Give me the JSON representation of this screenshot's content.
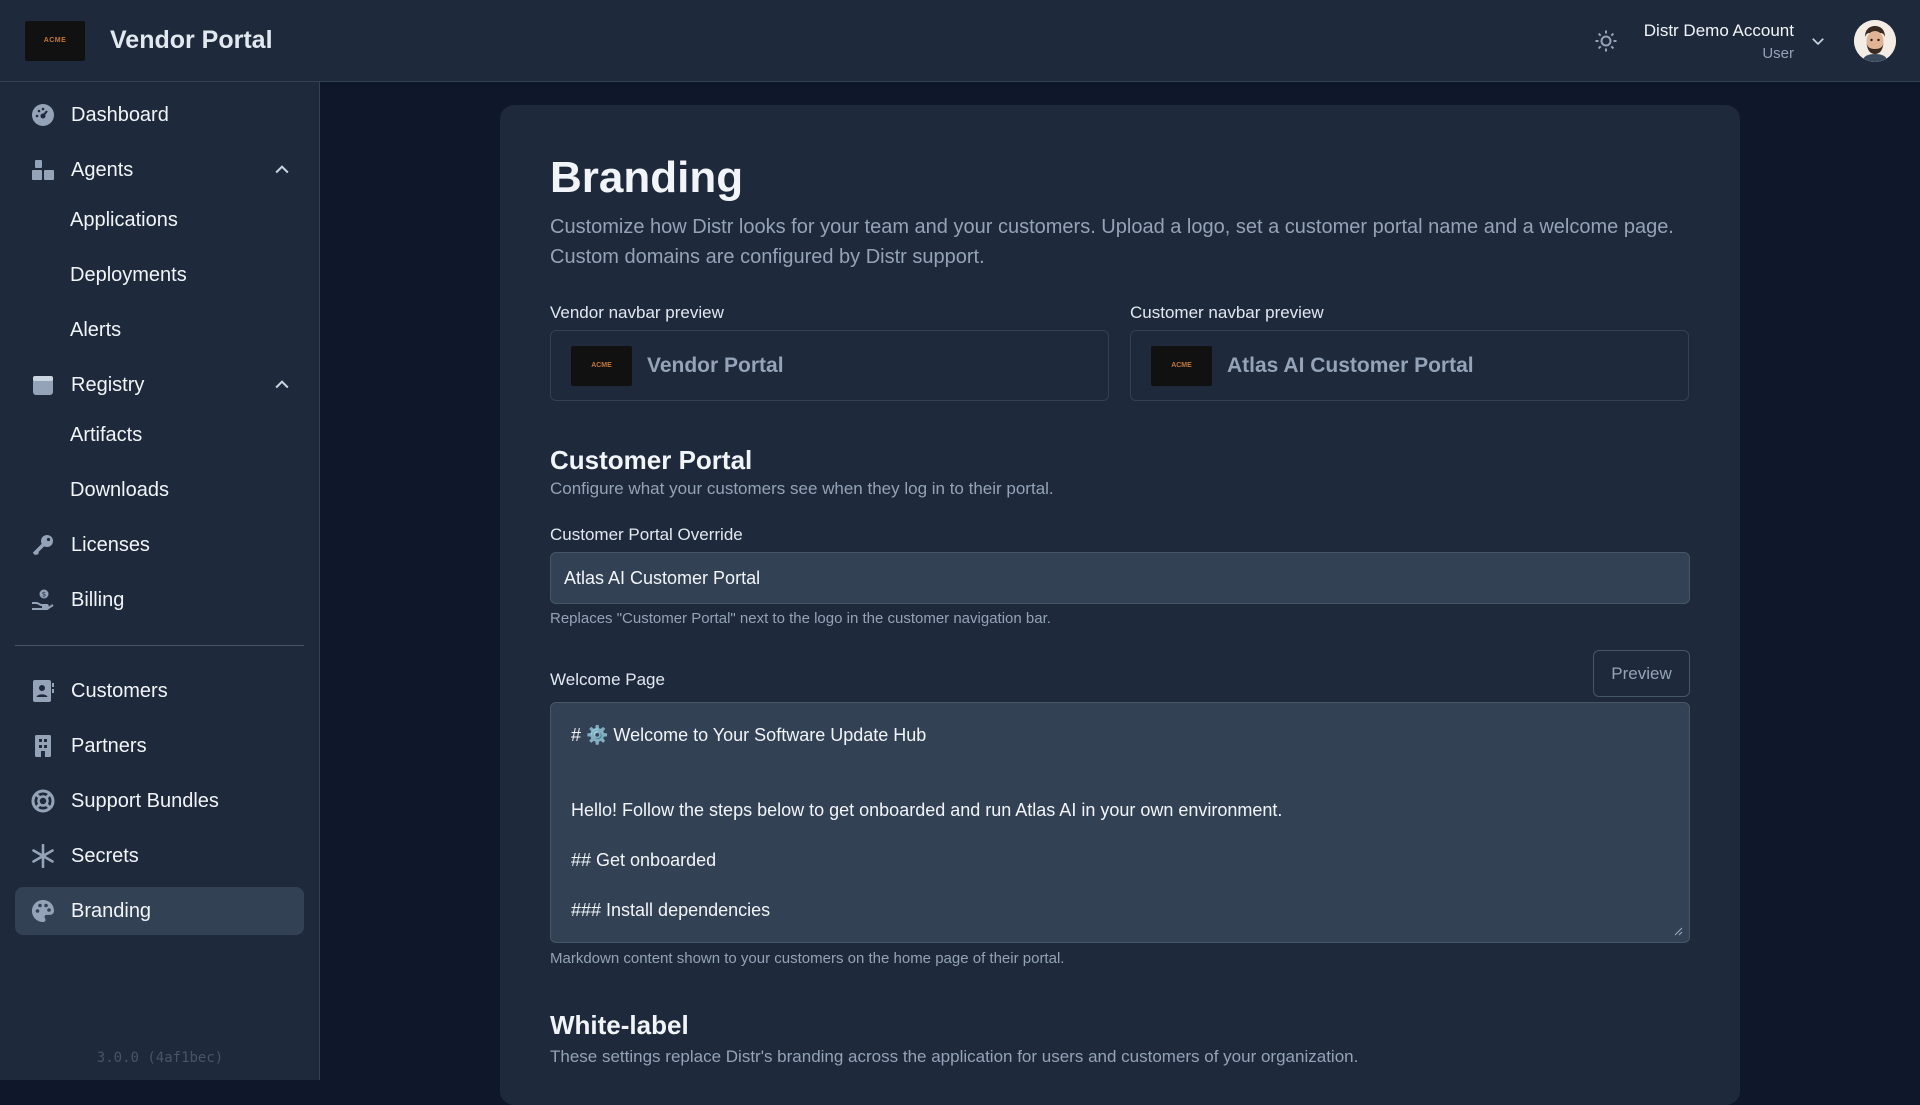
{
  "topbar": {
    "logo_text": "ACME",
    "title": "Vendor Portal",
    "account_name": "Distr Demo Account",
    "account_role": "User"
  },
  "sidebar": {
    "items": [
      {
        "label": "Dashboard",
        "icon": "dashboard-icon"
      },
      {
        "label": "Agents",
        "icon": "agents-icon",
        "expanded": true
      },
      {
        "label": "Applications"
      },
      {
        "label": "Deployments"
      },
      {
        "label": "Alerts"
      },
      {
        "label": "Registry",
        "icon": "registry-icon",
        "expanded": true
      },
      {
        "label": "Artifacts"
      },
      {
        "label": "Downloads"
      },
      {
        "label": "Licenses",
        "icon": "key-icon"
      },
      {
        "label": "Billing",
        "icon": "billing-icon"
      },
      {
        "label": "Customers",
        "icon": "customers-icon"
      },
      {
        "label": "Partners",
        "icon": "partners-icon"
      },
      {
        "label": "Support Bundles",
        "icon": "lifebuoy-icon"
      },
      {
        "label": "Secrets",
        "icon": "asterisk-icon"
      },
      {
        "label": "Branding",
        "icon": "palette-icon",
        "active": true
      }
    ],
    "version": "3.0.0 (4af1bec)"
  },
  "main": {
    "title": "Branding",
    "description": "Customize how Distr looks for your team and your customers. Upload a logo, set a customer portal name and a welcome page. Custom domains are configured by Distr support.",
    "vendor_preview_label": "Vendor navbar preview",
    "vendor_preview_title": "Vendor Portal",
    "customer_preview_label": "Customer navbar preview",
    "customer_preview_title": "Atlas AI Customer Portal",
    "preview_logo_text": "ACME",
    "customer_portal": {
      "title": "Customer Portal",
      "description": "Configure what your customers see when they log in to their portal.",
      "override_label": "Customer Portal Override",
      "override_value": "Atlas AI Customer Portal",
      "override_hint": "Replaces \"Customer Portal\" next to the logo in the customer navigation bar.",
      "welcome_label": "Welcome Page",
      "preview_button": "Preview",
      "welcome_lines": [
        "# ⚙️ Welcome to Your Software Update Hub",
        "Hello! Follow the steps below to get onboarded and run Atlas AI in your own environment.",
        "## Get onboarded",
        "### Install dependencies"
      ],
      "welcome_hint": "Markdown content shown to your customers on the home page of their portal."
    },
    "white_label": {
      "title": "White-label",
      "description": "These settings replace Distr's branding across the application for users and customers of your organization."
    }
  },
  "colors": {
    "background": "#0f172a",
    "surface": "#1e293b",
    "input": "#334155",
    "text": "#f1f5f9",
    "muted": "#94a3b8"
  }
}
